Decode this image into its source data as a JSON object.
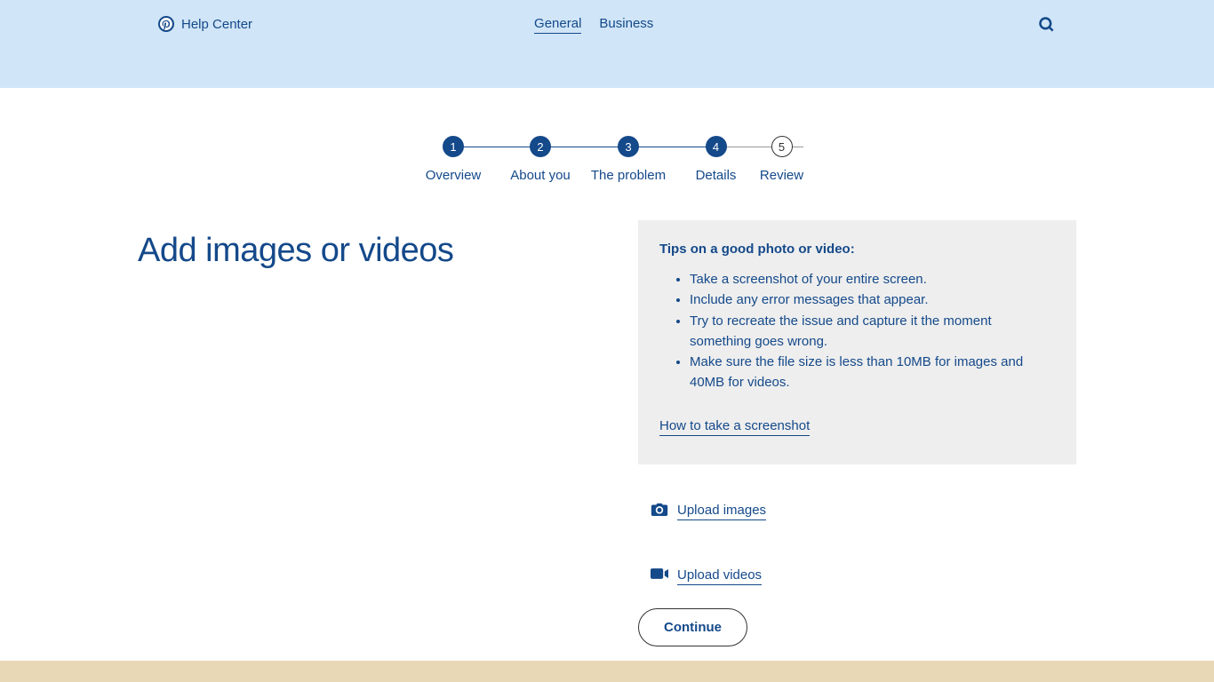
{
  "header": {
    "brand": "Help Center",
    "nav": {
      "general": "General",
      "business": "Business"
    }
  },
  "stepper": {
    "steps": [
      {
        "num": "1",
        "label": "Overview",
        "filled": true
      },
      {
        "num": "2",
        "label": "About you",
        "filled": true
      },
      {
        "num": "3",
        "label": "The problem",
        "filled": true
      },
      {
        "num": "4",
        "label": "Details",
        "filled": true
      },
      {
        "num": "5",
        "label": "Review",
        "filled": false
      }
    ]
  },
  "page": {
    "title": "Add images or videos"
  },
  "tips": {
    "title": "Tips on a good photo or video:",
    "items": [
      "Take a screenshot of your entire screen.",
      "Include any error messages that appear.",
      "Try to recreate the issue and capture it the moment something goes wrong.",
      "Make sure the file size is less than 10MB for images and 40MB for videos."
    ],
    "link": "How to take a screenshot"
  },
  "upload": {
    "images": "Upload images",
    "videos": "Upload videos"
  },
  "actions": {
    "continue": "Continue"
  }
}
